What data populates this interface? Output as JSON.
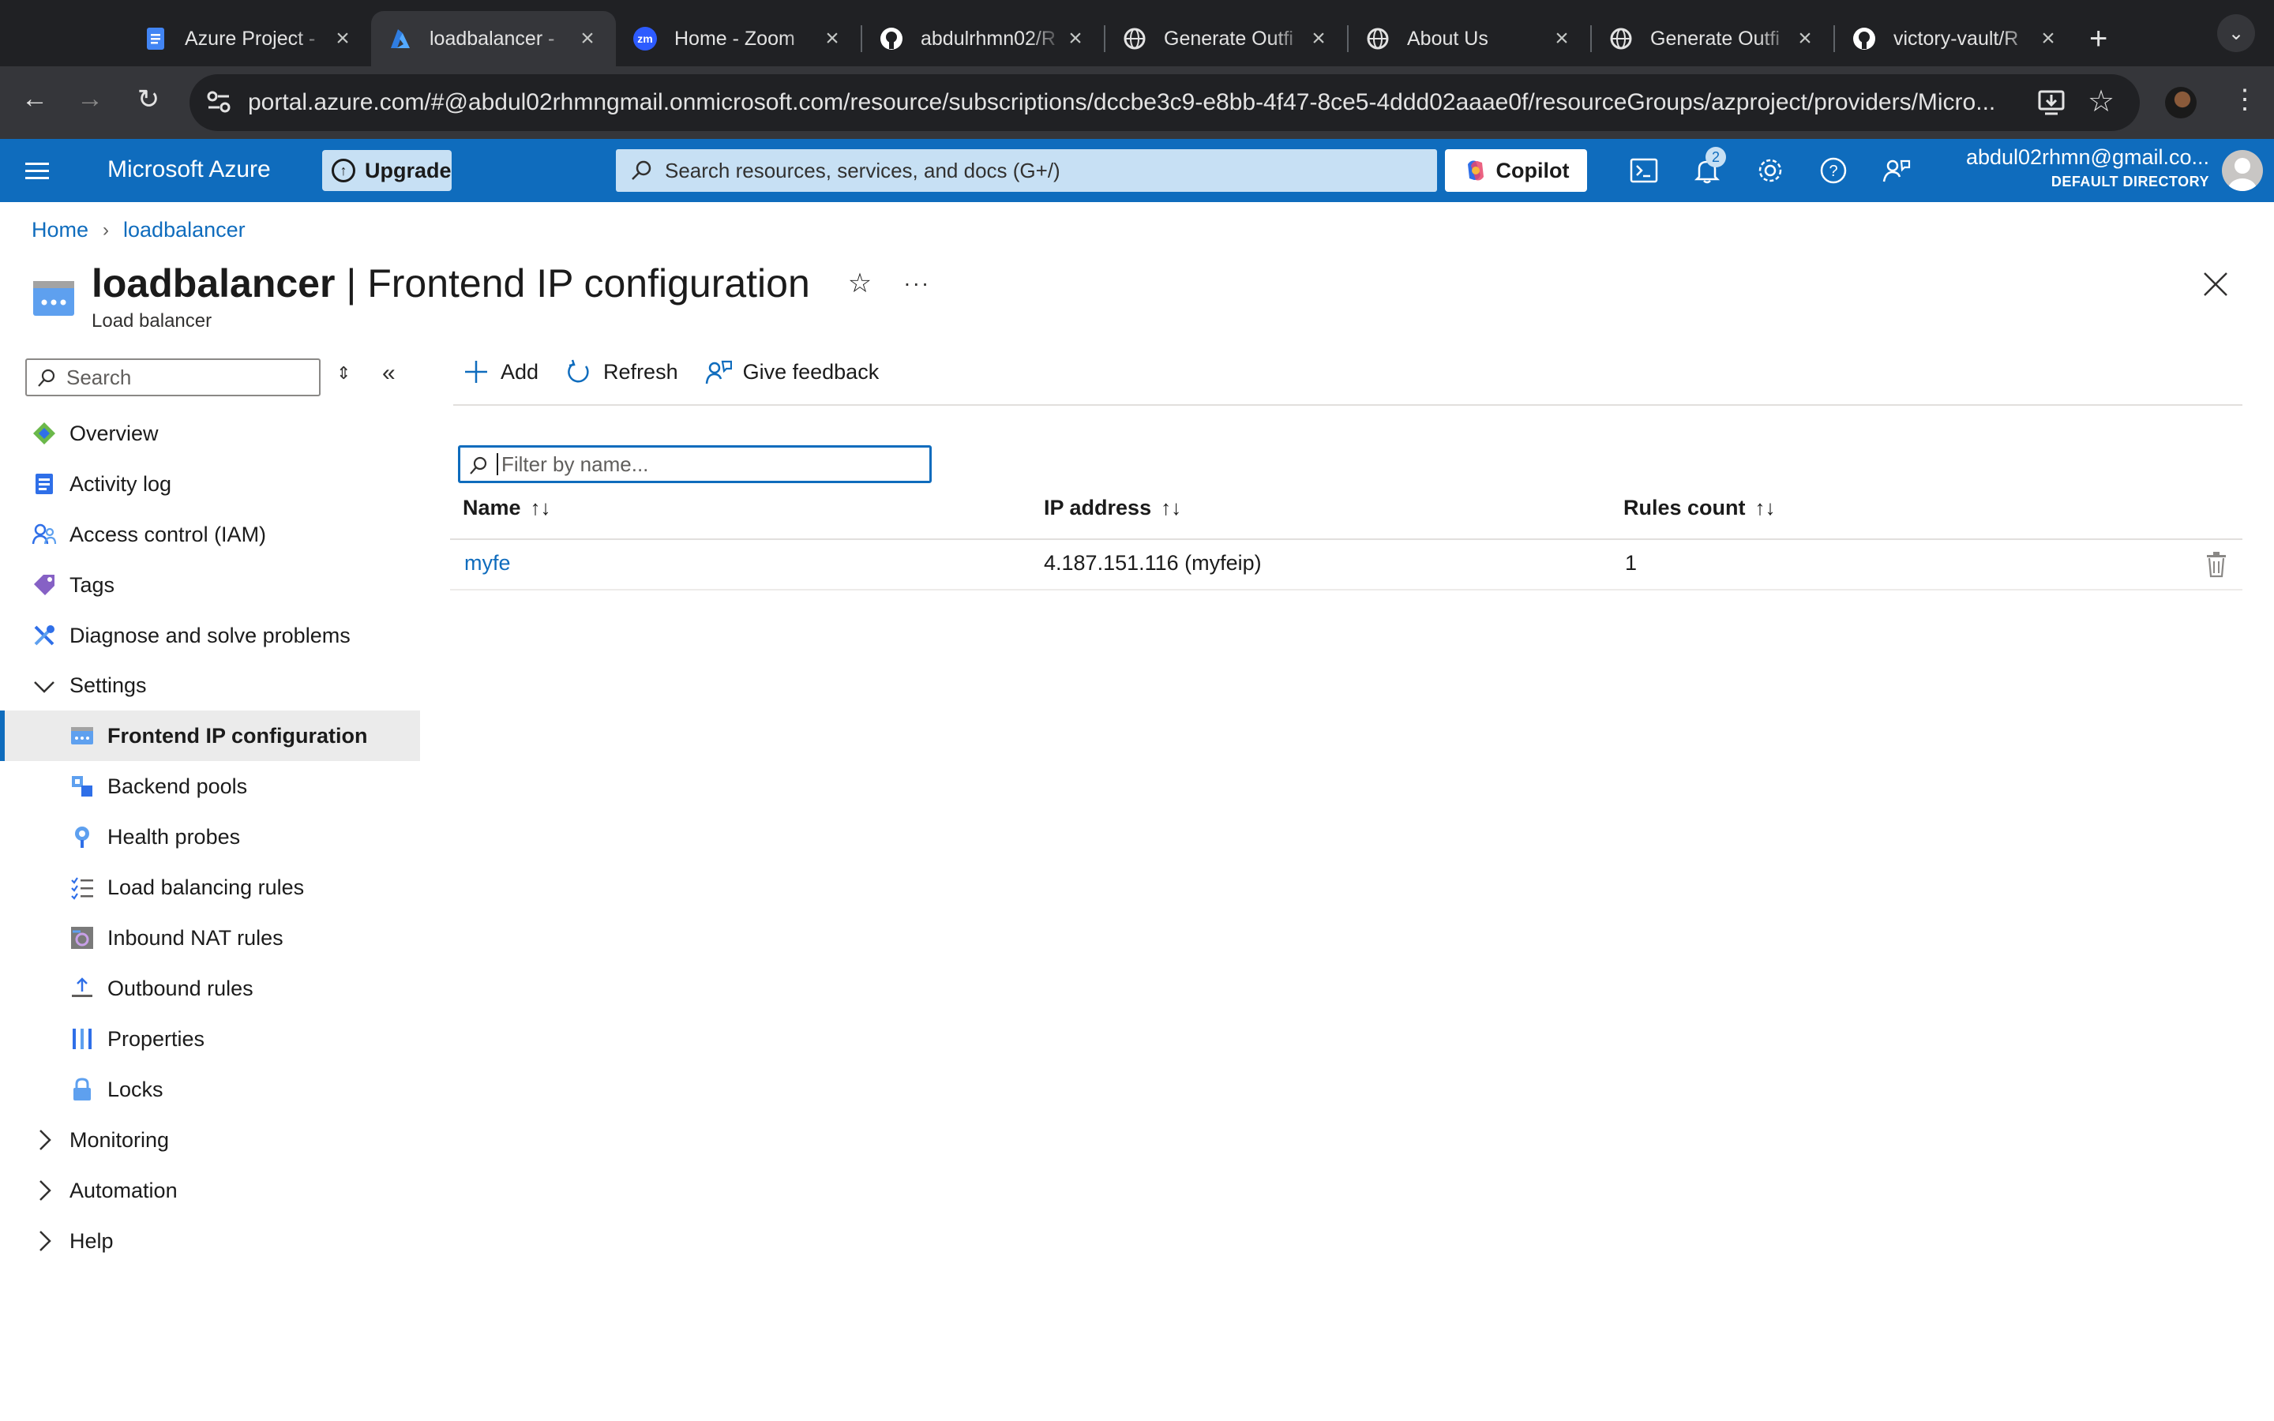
{
  "browser": {
    "tabs": [
      {
        "title": "Azure Project - ",
        "icon": "docs-icon",
        "color": "#4285f4"
      },
      {
        "title": "loadbalancer - ",
        "icon": "azure-icon",
        "color": "#0f6cbd"
      },
      {
        "title": "Home - Zoom",
        "icon": "zoom-icon",
        "color": "#2d5bff"
      },
      {
        "title": "abdulrhmn02/R",
        "icon": "github-icon",
        "color": "#ffffff"
      },
      {
        "title": "Generate Outfi",
        "icon": "globe-icon",
        "color": "#e3e3e3"
      },
      {
        "title": "About Us",
        "icon": "globe-icon",
        "color": "#e3e3e3"
      },
      {
        "title": "Generate Outfi",
        "icon": "globe-icon",
        "color": "#e3e3e3"
      },
      {
        "title": "victory-vault/R",
        "icon": "github-icon",
        "color": "#ffffff"
      }
    ],
    "url": "portal.azure.com/#@abdul02rhmngmail.onmicrosoft.com/resource/subscriptions/dccbe3c9-e8bb-4f47-8ce5-4ddd02aaae0f/resourceGroups/azproject/providers/Micro..."
  },
  "azure": {
    "brand": "Microsoft Azure",
    "upgrade": "Upgrade",
    "search_placeholder": "Search resources, services, and docs (G+/)",
    "copilot": "Copilot",
    "notifications_count": "2",
    "account_email": "abdul02rhmn@gmail.co...",
    "account_directory": "DEFAULT DIRECTORY",
    "accent": "#0f6cbd"
  },
  "breadcrumb": [
    "Home",
    "loadbalancer"
  ],
  "page": {
    "resource": "loadbalancer",
    "title_sep": " | ",
    "blade": "Frontend IP configuration",
    "type": "Load balancer"
  },
  "sidebar": {
    "search_placeholder": "Search",
    "items": [
      {
        "label": "Overview",
        "icon": "overview-icon"
      },
      {
        "label": "Activity log",
        "icon": "activity-log-icon"
      },
      {
        "label": "Access control (IAM)",
        "icon": "iam-icon"
      },
      {
        "label": "Tags",
        "icon": "tag-icon"
      },
      {
        "label": "Diagnose and solve problems",
        "icon": "wrench-icon"
      },
      {
        "label": "Settings",
        "icon": "chevron-down-icon"
      },
      {
        "label": "Frontend IP configuration",
        "icon": "frontend-ip-icon"
      },
      {
        "label": "Backend pools",
        "icon": "backend-pool-icon"
      },
      {
        "label": "Health probes",
        "icon": "health-probe-icon"
      },
      {
        "label": "Load balancing rules",
        "icon": "rules-list-icon"
      },
      {
        "label": "Inbound NAT rules",
        "icon": "nat-icon"
      },
      {
        "label": "Outbound rules",
        "icon": "outbound-icon"
      },
      {
        "label": "Properties",
        "icon": "properties-icon"
      },
      {
        "label": "Locks",
        "icon": "lock-icon"
      },
      {
        "label": "Monitoring",
        "icon": "chevron-right-icon"
      },
      {
        "label": "Automation",
        "icon": "chevron-right-icon"
      },
      {
        "label": "Help",
        "icon": "chevron-right-icon"
      }
    ]
  },
  "toolbar": {
    "add": "Add",
    "refresh": "Refresh",
    "feedback": "Give feedback"
  },
  "filter_placeholder": "Filter by name...",
  "grid": {
    "columns": [
      "Name",
      "IP address",
      "Rules count"
    ],
    "rows": [
      {
        "name": "myfe",
        "ip": "4.187.151.116 (myfeip)",
        "rules": "1"
      }
    ]
  }
}
